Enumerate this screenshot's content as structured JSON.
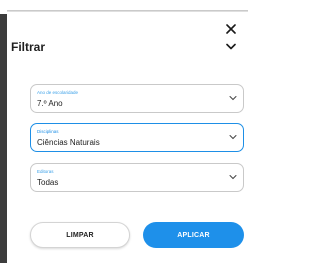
{
  "filter_panel": {
    "title": "Filtrar",
    "close_icon": "close-icon",
    "collapse_icon": "chevron-down-icon"
  },
  "fields": [
    {
      "label": "Ano de escolaridade",
      "value": "7.º Ano",
      "active": false
    },
    {
      "label": "Disciplinas",
      "value": "Ciências Naturais",
      "active": true
    },
    {
      "label": "Editoras",
      "value": "Todas",
      "active": false
    }
  ],
  "actions": {
    "clear_label": "LIMPAR",
    "apply_label": "APLICAR"
  },
  "colors": {
    "accent": "#1e90ea",
    "field_label": "#3aa0e8",
    "border": "#c9c9c9"
  }
}
